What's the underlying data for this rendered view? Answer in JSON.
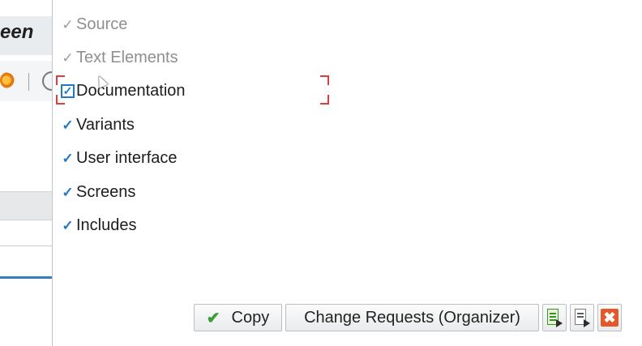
{
  "background_window": {
    "title_fragment": "een"
  },
  "options": [
    {
      "label": "Source",
      "checked": true,
      "enabled": false
    },
    {
      "label": "Text Elements",
      "checked": true,
      "enabled": false
    },
    {
      "label": "Documentation",
      "checked": true,
      "enabled": true,
      "focused": true
    },
    {
      "label": "Variants",
      "checked": true,
      "enabled": true
    },
    {
      "label": "User interface",
      "checked": true,
      "enabled": true
    },
    {
      "label": "Screens",
      "checked": true,
      "enabled": true
    },
    {
      "label": "Includes",
      "checked": true,
      "enabled": true
    }
  ],
  "footer": {
    "copy_label": "Copy",
    "change_requests_label": "Change Requests (Organizer)"
  },
  "icons": {
    "copy": "checkmark-icon",
    "select_all": "select-all-icon",
    "deselect_all": "deselect-all-icon",
    "cancel": "close-icon"
  },
  "colors": {
    "checkbox_blue": "#1f78c8",
    "focus_red": "#e23b3b",
    "cancel_red": "#e25a2a",
    "ok_green": "#3aa035"
  }
}
